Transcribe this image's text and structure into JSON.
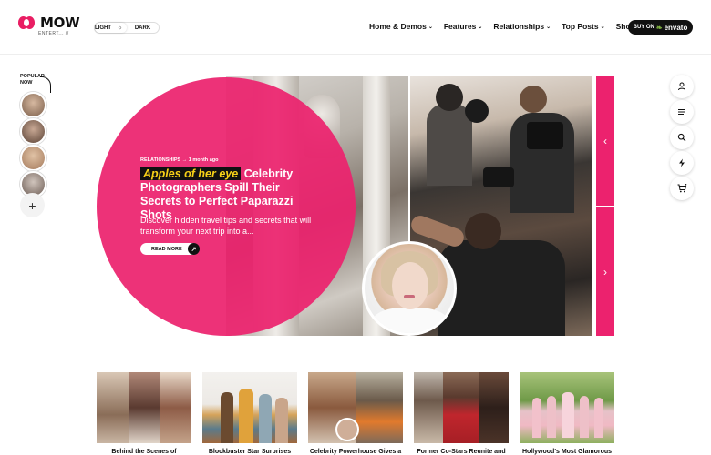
{
  "header": {
    "logo_text": "MOW",
    "logo_sub": "ENTERT... //",
    "theme": {
      "light_label": "LIGHT",
      "dark_label": "DARK"
    },
    "nav": [
      {
        "label": "Home & Demos"
      },
      {
        "label": "Features"
      },
      {
        "label": "Relationships"
      },
      {
        "label": "Top Posts"
      },
      {
        "label": "Shop"
      }
    ],
    "buy_button": {
      "prefix": "BUY ON",
      "brand": "envato"
    }
  },
  "popular": {
    "label": "POPULAR NOW",
    "add_symbol": "+"
  },
  "hero": {
    "category": "RELATIONSHIPS",
    "separator": "→",
    "time": "1 month ago",
    "highlight": "Apples of her eye",
    "title_rest": "Celebrity Photographers Spill Their Secrets to Perfect Paparazzi Shots",
    "excerpt": "Discover hidden travel tips and secrets that will transform your next trip into a...",
    "read_more": "READ MORE",
    "prev_symbol": "‹",
    "next_symbol": "›"
  },
  "cards": [
    {
      "title": "Behind the Scenes of"
    },
    {
      "title": "Blockbuster Star Surprises"
    },
    {
      "title": "Celebrity Powerhouse Gives a"
    },
    {
      "title": "Former Co-Stars Reunite and"
    },
    {
      "title": "Hollywood's Most Glamorous"
    }
  ],
  "colors": {
    "accent": "#ec226e",
    "highlight_text": "#f7d117",
    "dark": "#111111"
  },
  "icons": [
    "user-icon",
    "menu-icon",
    "search-icon",
    "bolt-icon",
    "cart-icon"
  ]
}
